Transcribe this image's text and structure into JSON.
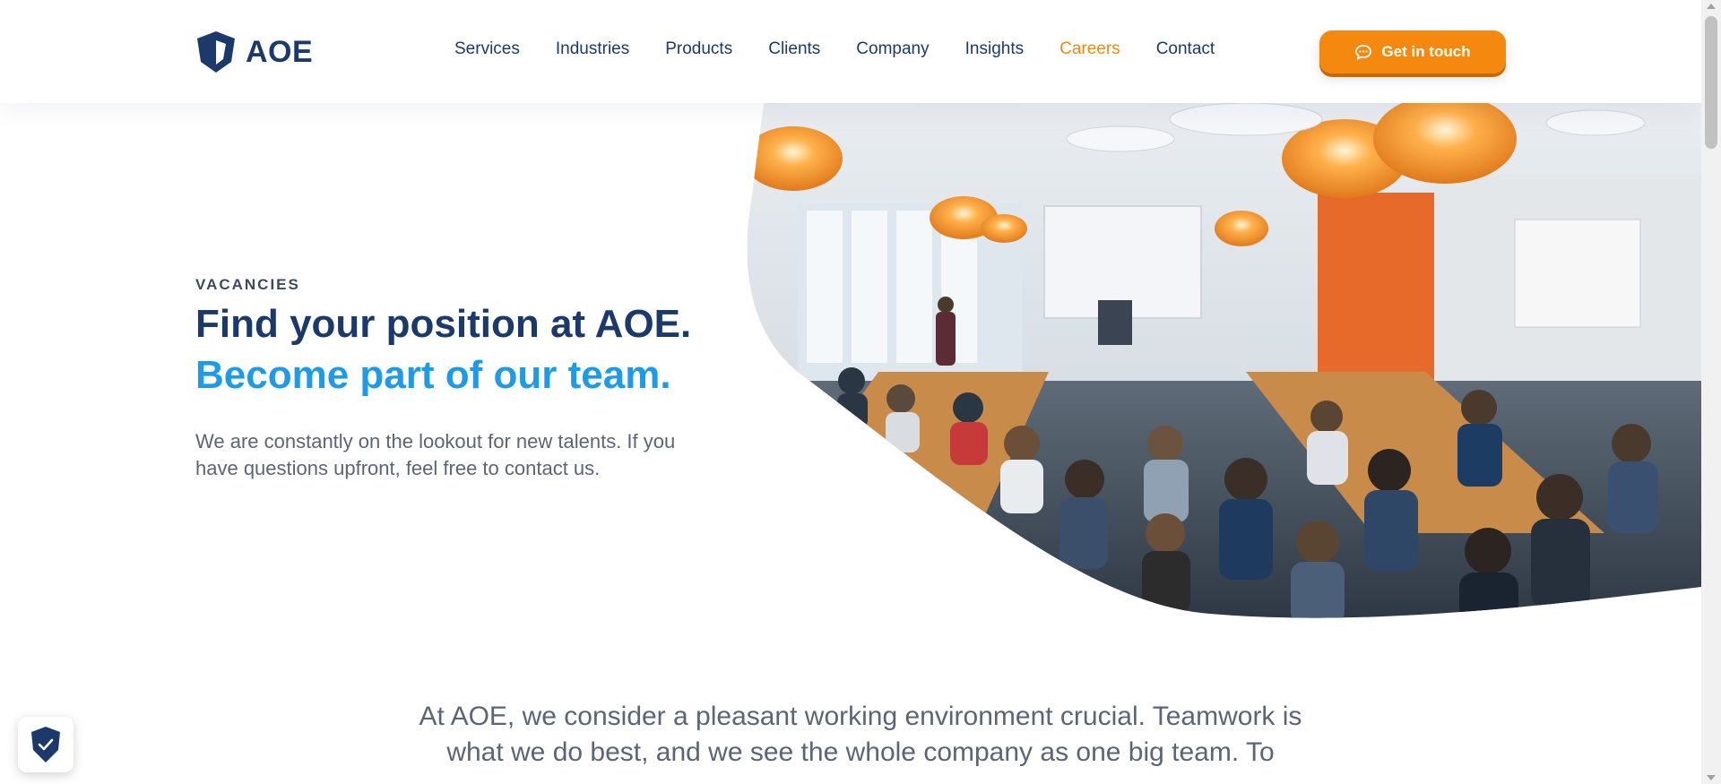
{
  "brand": {
    "name": "AOE",
    "logo_icon": "aoe-shield-logo",
    "primary_color": "#1b3a6b",
    "accent_color": "#f5890f",
    "highlight_color": "#1e9be8"
  },
  "nav": {
    "items": [
      {
        "label": "Services",
        "active": false
      },
      {
        "label": "Industries",
        "active": false
      },
      {
        "label": "Products",
        "active": false
      },
      {
        "label": "Clients",
        "active": false
      },
      {
        "label": "Company",
        "active": false
      },
      {
        "label": "Insights",
        "active": false
      },
      {
        "label": "Careers",
        "active": true
      },
      {
        "label": "Contact",
        "active": false
      }
    ],
    "cta_label": "Get in touch",
    "cta_icon": "chat-bubble-icon"
  },
  "hero": {
    "eyebrow": "VACANCIES",
    "title_line1": "Find your position at AOE.",
    "title_line2": "Become part of our team.",
    "lead": "We are constantly on the lookout for new talents. If you have questions upfront, feel free to contact us.",
    "image": "office-team-meeting-photo"
  },
  "intro": {
    "text": "At AOE, we consider a pleasant working environment crucial. Teamwork is what we do best, and we see the whole company as one big team. To"
  },
  "privacy_badge": {
    "icon": "shield-check-icon"
  }
}
